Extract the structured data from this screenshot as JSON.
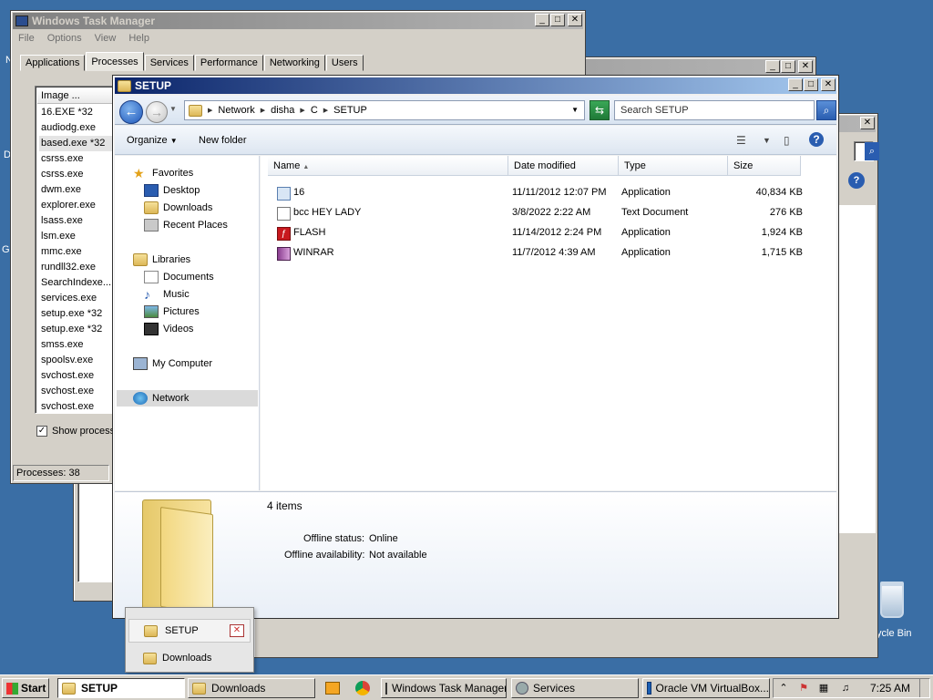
{
  "desktop": {
    "frag_left_1": "N",
    "frag_left_2": "D",
    "frag_left_3": "G",
    "recycle_bin_label": "ycle Bin"
  },
  "task_manager": {
    "title": "Windows Task Manager",
    "menu": [
      "File",
      "Options",
      "View",
      "Help"
    ],
    "tabs": [
      "Applications",
      "Processes",
      "Services",
      "Performance",
      "Networking",
      "Users"
    ],
    "selected_tab": "Processes",
    "column_image": "Image ...",
    "processes": [
      "16.EXE *32",
      "audiodg.exe",
      "based.exe *32",
      "csrss.exe",
      "csrss.exe",
      "dwm.exe",
      "explorer.exe",
      "lsass.exe",
      "lsm.exe",
      "mmc.exe",
      "rundll32.exe",
      "SearchIndexe...",
      "services.exe",
      "setup.exe *32",
      "setup.exe *32",
      "smss.exe",
      "spoolsv.exe",
      "svchost.exe",
      "svchost.exe",
      "svchost.exe"
    ],
    "show_processes_label": "Show process",
    "status": "Processes: 38"
  },
  "explorer": {
    "title": "SETUP",
    "breadcrumb": [
      "Network",
      "disha",
      "C",
      "SETUP"
    ],
    "search_placeholder": "Search SETUP",
    "toolbar": {
      "organize": "Organize",
      "new_folder": "New folder"
    },
    "nav": {
      "favorites": "Favorites",
      "desktop": "Desktop",
      "downloads": "Downloads",
      "recent": "Recent Places",
      "libraries": "Libraries",
      "documents": "Documents",
      "music": "Music",
      "pictures": "Pictures",
      "videos": "Videos",
      "my_computer": "My Computer",
      "network": "Network"
    },
    "columns": {
      "name": "Name",
      "date": "Date modified",
      "type": "Type",
      "size": "Size"
    },
    "files": [
      {
        "name": "16",
        "date": "11/11/2012 12:07 PM",
        "type": "Application",
        "size": "40,834 KB"
      },
      {
        "name": "bcc HEY LADY",
        "date": "3/8/2022 2:22 AM",
        "type": "Text Document",
        "size": "276 KB"
      },
      {
        "name": "FLASH",
        "date": "11/14/2012 2:24 PM",
        "type": "Application",
        "size": "1,924 KB"
      },
      {
        "name": "WINRAR",
        "date": "11/7/2012 4:39 AM",
        "type": "Application",
        "size": "1,715 KB"
      }
    ],
    "details": {
      "count": "4 items",
      "offline_status_label": "Offline status:",
      "offline_status_value": "Online",
      "offline_avail_label": "Offline availability:",
      "offline_avail_value": "Not available"
    }
  },
  "jumplist": {
    "item1": "SETUP",
    "item2": "Downloads"
  },
  "taskbar": {
    "start": "Start",
    "items": [
      "SETUP",
      "Downloads",
      "Windows Task Manager",
      "Services",
      "Oracle VM VirtualBox..."
    ],
    "clock": "7:25 AM"
  }
}
